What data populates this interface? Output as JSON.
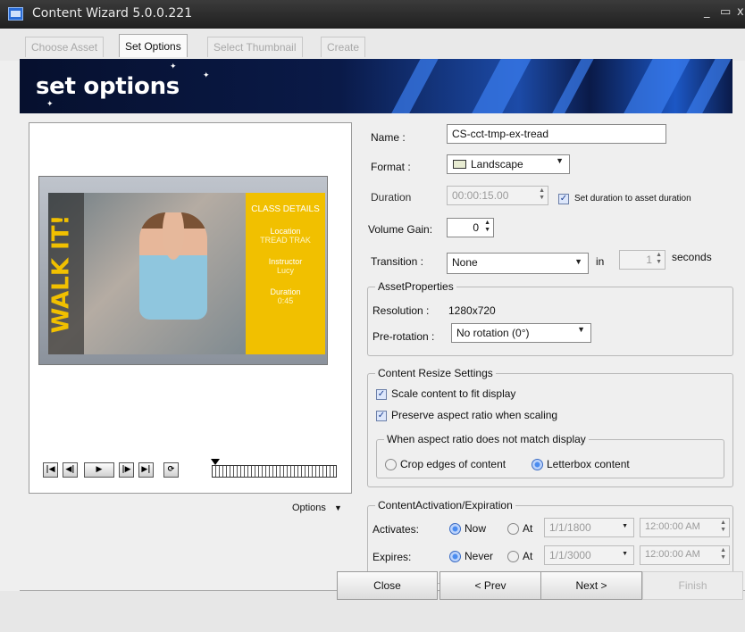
{
  "window": {
    "title": "Content Wizard 5.0.0.221",
    "controls": [
      "_",
      "▭",
      "x"
    ]
  },
  "tabs": [
    {
      "label": "Choose Asset",
      "active": false
    },
    {
      "label": "Set Options",
      "active": true
    },
    {
      "label": "Select Thumbnail",
      "active": false
    },
    {
      "label": "Create",
      "active": false
    }
  ],
  "banner": {
    "title": "set options"
  },
  "preview": {
    "side_text": "WALK IT!",
    "panel": {
      "heading": "CLASS DETAILS",
      "location_label": "Location",
      "location_value": "TREAD TRAK",
      "instructor_label": "Instructor",
      "instructor_value": "Lucy",
      "duration_label": "Duration",
      "duration_value": "0:45"
    },
    "options_label": "Options"
  },
  "form": {
    "name_label": "Name :",
    "name_value": "CS-cct-tmp-ex-tread",
    "format_label": "Format :",
    "format_value": "Landscape",
    "duration_label": "Duration",
    "duration_value": "00:00:15.00",
    "duration_checkbox_label": "Set duration to asset duration",
    "volume_label": "Volume Gain:",
    "volume_value": "0",
    "transition_label": "Transition :",
    "transition_value": "None",
    "transition_in": "in",
    "transition_seconds_value": "1",
    "transition_seconds_label": "seconds"
  },
  "asset_properties": {
    "legend": "AssetProperties",
    "resolution_label": "Resolution :",
    "resolution_value": "1280x720",
    "prerotation_label": "Pre-rotation :",
    "prerotation_value": "No rotation (0°)"
  },
  "resize": {
    "legend": "Content Resize Settings",
    "scale_label": "Scale content to fit display",
    "scale_checked": true,
    "preserve_label": "Preserve aspect ratio when scaling",
    "preserve_checked": true,
    "aspect_legend": "When aspect ratio does not match display",
    "crop_label": "Crop edges of content",
    "letterbox_label": "Letterbox content",
    "selected": "letterbox"
  },
  "activation": {
    "legend": "ContentActivation/Expiration",
    "activates_label": "Activates:",
    "activates_now": "Now",
    "activates_at": "At",
    "activates_date": "1/1/1800",
    "activates_time": "12:00:00 AM",
    "expires_label": "Expires:",
    "expires_never": "Never",
    "expires_at": "At",
    "expires_date": "1/1/3000",
    "expires_time": "12:00:00 AM"
  },
  "footer": {
    "close": "Close",
    "prev": "< Prev",
    "next": "Next >",
    "finish": "Finish"
  },
  "colors": {
    "banner_bg": "#0a1a48",
    "accent_yellow": "#f1c000",
    "radio_selected": "#4b8cf0"
  }
}
